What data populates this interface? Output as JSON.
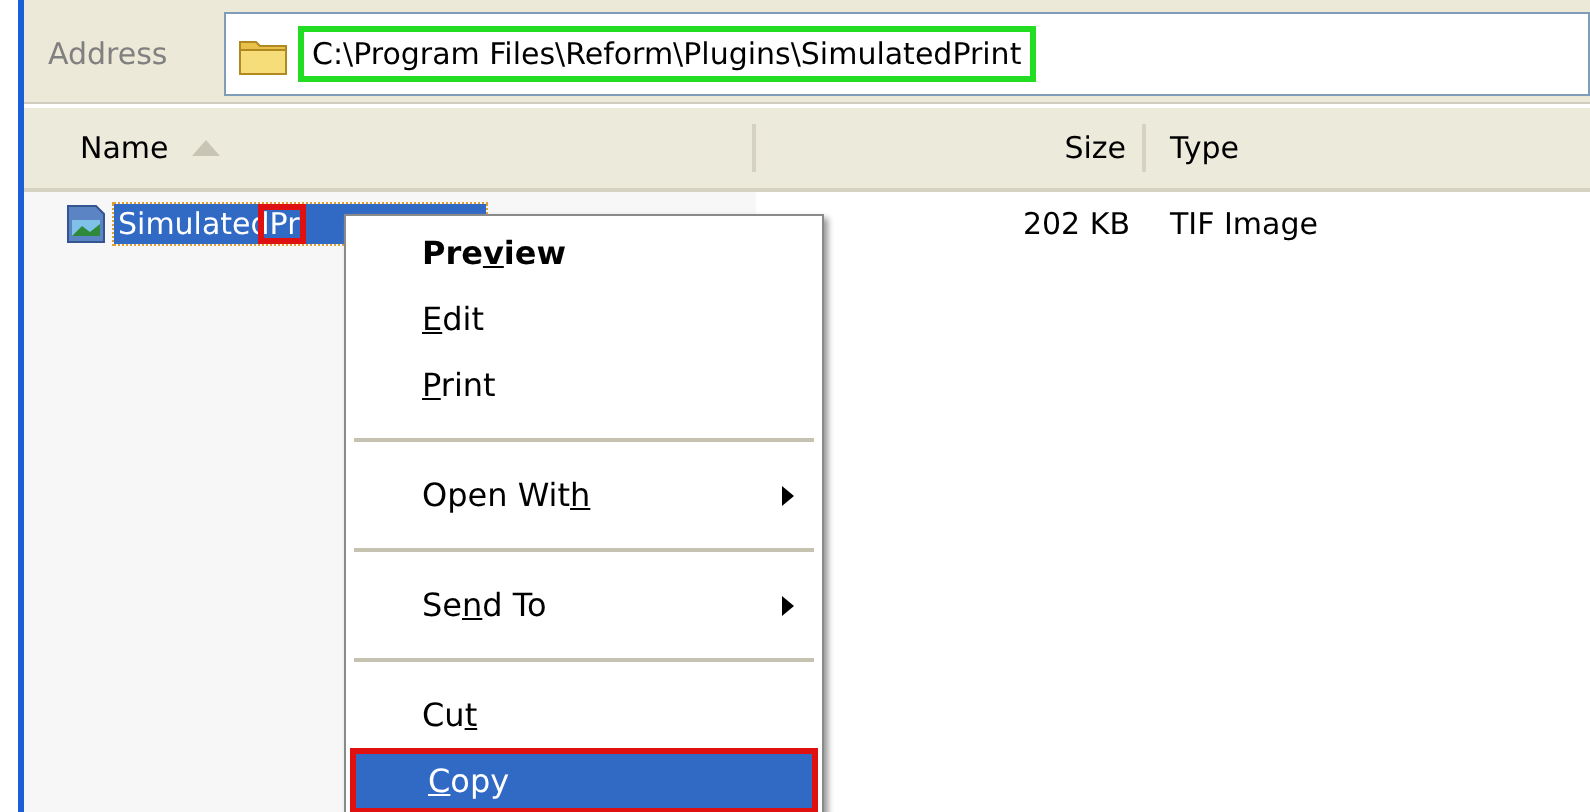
{
  "address_bar": {
    "label": "Address",
    "path": "C:\\Program Files\\Reform\\Plugins\\SimulatedPrint",
    "outlined": true
  },
  "columns": [
    {
      "label": "Name",
      "sorted": true
    },
    {
      "label": "Size",
      "sorted": false
    },
    {
      "label": "Type",
      "sorted": false
    }
  ],
  "files": [
    {
      "name": "SimulatedPr",
      "size": "202 KB",
      "type": "TIF Image",
      "selected": true,
      "tail_outlined": true
    }
  ],
  "context_menu": [
    {
      "kind": "item",
      "before_key": "Pre",
      "key": "v",
      "after_key": "iew",
      "default": true,
      "selected": false,
      "outlined": false,
      "submenu": false
    },
    {
      "kind": "item",
      "key": "E",
      "after_key": "dit",
      "default": false,
      "selected": false,
      "outlined": false,
      "submenu": false
    },
    {
      "kind": "item",
      "key": "P",
      "after_key": "rint",
      "default": false,
      "selected": false,
      "outlined": false,
      "submenu": false
    },
    {
      "kind": "separator"
    },
    {
      "kind": "item",
      "before_key": "Open Wit",
      "key": "h",
      "default": false,
      "selected": false,
      "outlined": false,
      "submenu": true
    },
    {
      "kind": "separator"
    },
    {
      "kind": "item",
      "before_key": "Se",
      "key": "n",
      "after_key": "d To",
      "default": false,
      "selected": false,
      "outlined": false,
      "submenu": true
    },
    {
      "kind": "separator"
    },
    {
      "kind": "item",
      "before_key": "Cu",
      "key": "t",
      "default": false,
      "selected": false,
      "outlined": false,
      "submenu": false
    },
    {
      "kind": "item",
      "key": "C",
      "after_key": "opy",
      "default": false,
      "selected": true,
      "outlined": true,
      "submenu": false
    }
  ]
}
